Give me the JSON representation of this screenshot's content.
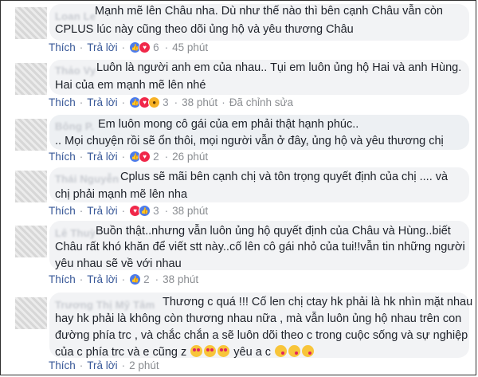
{
  "actions": {
    "like": "Thích",
    "reply": "Trả lời",
    "separator": "·"
  },
  "comments": [
    {
      "author": "Loan Le",
      "lines": [
        "Mạnh mẽ lên Châu nha. Dù như thế nào thì bên cạnh Châu vẫn còn",
        "CPLUS lúc này cũng theo dõi ủng hộ và yêu thương Châu"
      ],
      "reactions": [
        "like",
        "love"
      ],
      "reaction_count": "6",
      "time": "45 phút",
      "edited": ""
    },
    {
      "author": "Thảo Vy",
      "lines": [
        "Luôn là người anh em của nhau.. Tụi em luôn ủng hộ Hai và anh Hùng.",
        "Hai của em mạnh mẽ lên nhé"
      ],
      "reactions": [
        "like",
        "love",
        "wow"
      ],
      "reaction_count": "3",
      "time": "38 phút",
      "edited": "Đã chỉnh sửa"
    },
    {
      "author": "Bông P.",
      "lines": [
        "Em luôn mong cô gái của em phải thật hạnh phúc..",
        ".. Mọi chuyện rồi sẽ ổn thôi, mọi người vẫn ở đây, ủng hộ và yêu thương chị"
      ],
      "reactions": [
        "like",
        "love"
      ],
      "reaction_count": "2",
      "time": "26 phút",
      "edited": ""
    },
    {
      "author": "Thái Nguyễn",
      "lines": [
        "Cplus sẽ mãi bên cạnh chị và tôn trọng quyết định của chị .... và",
        "chị phải mạnh mẽ lên nha"
      ],
      "reactions": [
        "like",
        "love"
      ],
      "reaction_count": "3",
      "time": "38 phút",
      "edited": ""
    },
    {
      "author": "Lê Thuỳ",
      "lines": [
        "Buồn thật..nhưng vẫn luôn ủng hộ quyết định của Châu và Hùng..biết",
        "Châu rất khó khăn để viết stt này..cố lên cô gái nhỏ của tui!!vẫn tin những người",
        "yêu nhau sẽ về với nhau"
      ],
      "reactions": [
        "like"
      ],
      "reaction_count": "2",
      "time": "38 phút",
      "edited": ""
    },
    {
      "author": "Trương Thị Mỹ Tâm",
      "lines": [
        "Thương c quá !!! Cố len chị ctay hk phải là hk nhìn mặt nhau",
        "hay hk phải là không còn thương nhau nữa , mà vẫn luôn ủng hộ nhau trên con",
        "đường phía trc , và chắc chắn a sẽ luôn dõi theo c trong cuộc sống và sự nghiệp",
        "của c phía trc và e cũng z",
        "yêu a c"
      ],
      "reactions": [],
      "reaction_count": "",
      "time": "2 phút",
      "edited": ""
    }
  ]
}
